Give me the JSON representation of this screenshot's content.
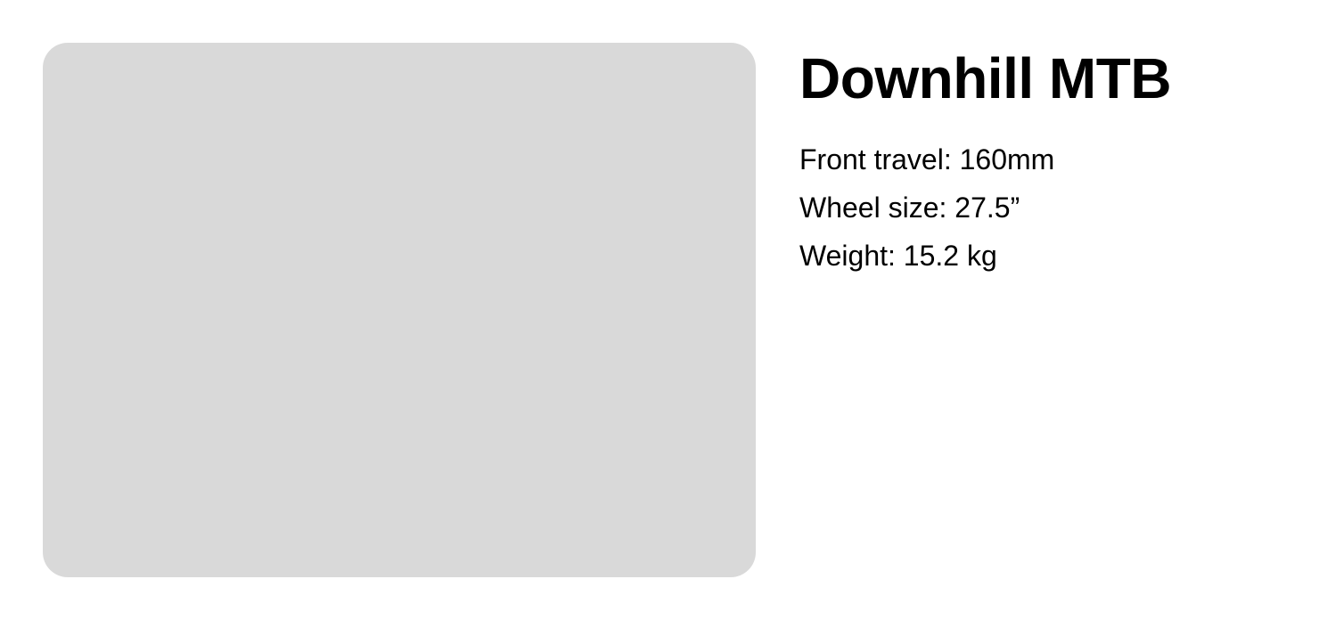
{
  "product": {
    "name": "Downhill MTB",
    "image_color": "#d9d9d9",
    "specs": [
      "Front travel: 160mm",
      "Wheel size: 27.5”",
      "Weight: 15.2 kg"
    ]
  }
}
